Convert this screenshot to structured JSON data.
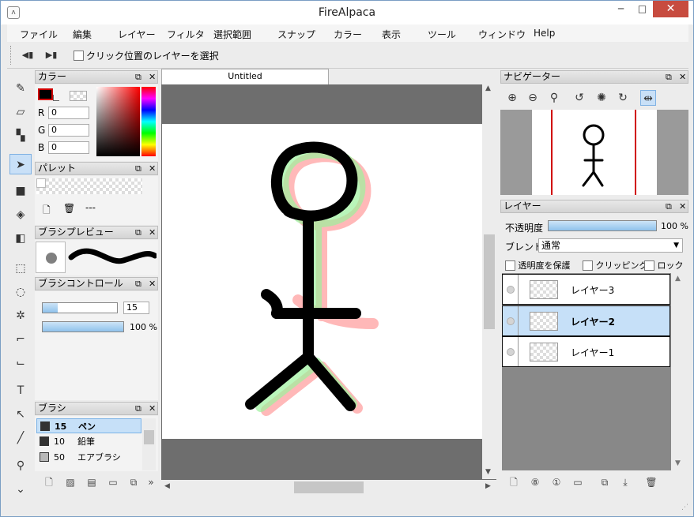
{
  "window": {
    "title": "FireAlpaca",
    "minimize": "─",
    "maximize": "□",
    "close": "✕",
    "app_icon": "alpaca-icon"
  },
  "menu": [
    "ファイル",
    "編集",
    "レイヤー",
    "フィルタ",
    "選択範囲",
    "スナップ",
    "カラー",
    "表示",
    "ツール",
    "ウィンドウ",
    "Help"
  ],
  "toolbar": {
    "prev": "◀▮",
    "next": "▶▮",
    "select_layer_label": "クリック位置のレイヤーを選択",
    "select_layer_checked": false
  },
  "tools": [
    "pen-icon",
    "eraser-icon",
    "dot-icon",
    "move-icon",
    "fill-icon",
    "bucket-icon",
    "gradient-icon",
    "select-rect-icon",
    "lasso-icon",
    "magic-wand-icon",
    "select-pen-icon",
    "select-eraser-icon",
    "text-icon",
    "operation-icon",
    "blur-icon",
    "eyedropper-icon",
    "more-icon"
  ],
  "color_panel": {
    "title": "カラー",
    "r_label": "R",
    "g_label": "G",
    "b_label": "B",
    "r": "0",
    "g": "0",
    "b": "0",
    "foreground": "#000000",
    "accent_border": "#d00000"
  },
  "palette_panel": {
    "title": "パレット",
    "empty": "---"
  },
  "brush_preview_panel": {
    "title": "ブラシプレビュー"
  },
  "brush_control_panel": {
    "title": "ブラシコントロール",
    "size": "15",
    "size_fraction": 0.2,
    "opacity": "100 %",
    "opacity_fraction": 1.0
  },
  "brush_panel": {
    "title": "ブラシ",
    "items": [
      {
        "size": "15",
        "name": "ペン",
        "color": "#333333"
      },
      {
        "size": "10",
        "name": "鉛筆",
        "color": "#333333"
      },
      {
        "size": "50",
        "name": "エアブラシ",
        "color": "#b8b8b8"
      }
    ]
  },
  "document": {
    "tab": "Untitled"
  },
  "navigator_panel": {
    "title": "ナビゲーター"
  },
  "layer_panel": {
    "title": "レイヤー",
    "opacity_label": "不透明度",
    "opacity": "100 %",
    "opacity_fraction": 1.0,
    "blend_label": "ブレンド",
    "blend_value": "通常",
    "protect_alpha": "透明度を保護",
    "clipping": "クリッピング",
    "lock": "ロック",
    "layers": [
      {
        "name": "レイヤー3",
        "selected": false
      },
      {
        "name": "レイヤー2",
        "selected": true
      },
      {
        "name": "レイヤー1",
        "selected": false
      }
    ]
  }
}
